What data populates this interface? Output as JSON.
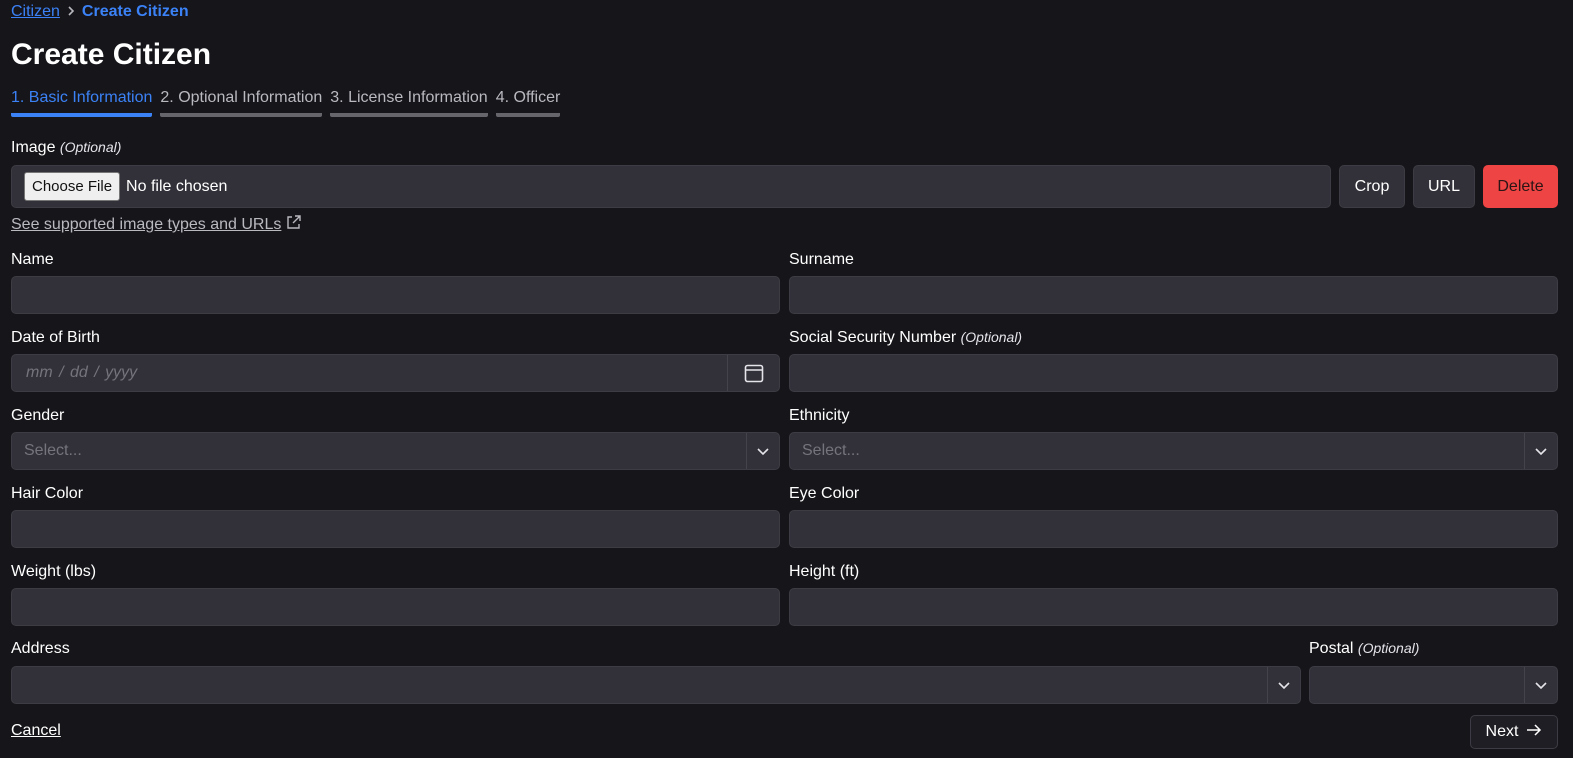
{
  "breadcrumb": {
    "parent": "Citizen",
    "current": "Create Citizen"
  },
  "page_title": "Create Citizen",
  "tabs": [
    {
      "label": "1. Basic Information",
      "active": true
    },
    {
      "label": "2. Optional Information",
      "active": false
    },
    {
      "label": "3. License Information",
      "active": false
    },
    {
      "label": "4. Officer",
      "active": false
    }
  ],
  "image": {
    "label": "Image",
    "optional": "(Optional)",
    "choose_file": "Choose File",
    "no_file": "No file chosen",
    "crop": "Crop",
    "url": "URL",
    "delete": "Delete",
    "supported_link": "See supported image types and URLs"
  },
  "fields": {
    "name": {
      "label": "Name",
      "value": ""
    },
    "surname": {
      "label": "Surname",
      "value": ""
    },
    "dob": {
      "label": "Date of Birth",
      "placeholder": "mm / dd / yyyy"
    },
    "ssn": {
      "label": "Social Security Number",
      "optional": "(Optional)",
      "value": ""
    },
    "gender": {
      "label": "Gender",
      "placeholder": "Select..."
    },
    "ethnicity": {
      "label": "Ethnicity",
      "placeholder": "Select..."
    },
    "hair_color": {
      "label": "Hair Color",
      "value": ""
    },
    "eye_color": {
      "label": "Eye Color",
      "value": ""
    },
    "weight": {
      "label": "Weight (lbs)",
      "value": ""
    },
    "height": {
      "label": "Height (ft)",
      "value": ""
    },
    "address": {
      "label": "Address",
      "value": ""
    },
    "postal": {
      "label": "Postal",
      "optional": "(Optional)",
      "value": ""
    }
  },
  "actions": {
    "cancel": "Cancel",
    "next": "Next"
  },
  "colors": {
    "accent": "#3b82f6",
    "danger": "#ef4444",
    "background": "#16151a",
    "field": "#323139"
  }
}
